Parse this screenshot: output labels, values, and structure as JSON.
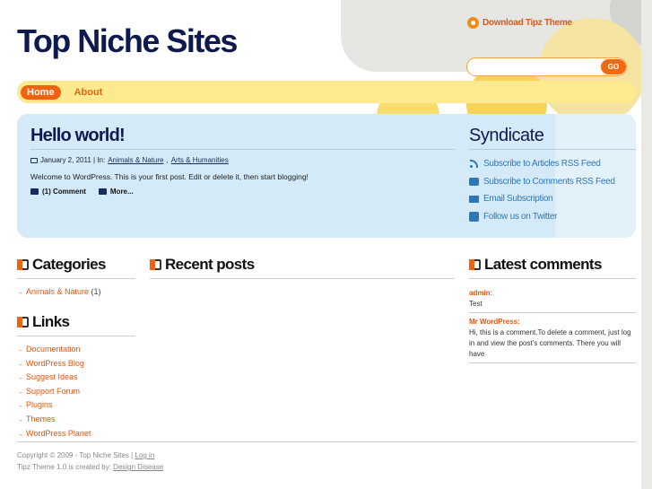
{
  "site": {
    "title": "Top Niche Sites",
    "download_link": "Download Tipz Theme"
  },
  "search": {
    "placeholder": "",
    "button_label": "GO"
  },
  "nav": {
    "items": [
      {
        "label": "Home",
        "active": true
      },
      {
        "label": "About",
        "active": false
      }
    ]
  },
  "post": {
    "title": "Hello world!",
    "date_prefix": "January 2, 2011 | In:",
    "categories": [
      "Animals & Nature",
      "Arts & Humanities"
    ],
    "category_separator": ",",
    "body": "Welcome to WordPress. This is your first post. Edit or delete it, then start blogging!",
    "comments_label": "(1) Comment",
    "more_label": "More..."
  },
  "syndicate": {
    "title": "Syndicate",
    "items": [
      {
        "label": "Subscribe to Articles RSS Feed",
        "icon": "rss-icon"
      },
      {
        "label": "Subscribe to Comments RSS Feed",
        "icon": "comment-icon"
      },
      {
        "label": "Email Subscription",
        "icon": "mail-icon"
      },
      {
        "label": "Follow us on Twitter",
        "icon": "twitter-icon"
      }
    ]
  },
  "categories_widget": {
    "title": "Categories",
    "items": [
      {
        "label": "Animals & Nature",
        "count": "(1)"
      }
    ]
  },
  "links_widget": {
    "title": "Links",
    "items": [
      {
        "label": "Documentation"
      },
      {
        "label": "WordPress Blog"
      },
      {
        "label": "Suggest Ideas"
      },
      {
        "label": "Support Forum"
      },
      {
        "label": "Plugins"
      },
      {
        "label": "Themes"
      },
      {
        "label": "WordPress Planet"
      }
    ]
  },
  "recent_posts_widget": {
    "title": "Recent posts"
  },
  "latest_comments_widget": {
    "title": "Latest comments",
    "comments": [
      {
        "author": "admin:",
        "text": "Test"
      },
      {
        "author": "Mr WordPress:",
        "text": "Hi, this is a comment.To delete a comment, just log in and view the post's comments. There you will have"
      }
    ]
  },
  "footer": {
    "copyright": "Copyright © 2009 - Top Niche Sites |",
    "login_label": "Log in",
    "credit_prefix": "Tipz Theme 1.0 is created by:",
    "credit_link": "Design Disease"
  },
  "colors": {
    "accent": "#f1620f",
    "title_navy": "#0e1a4d",
    "nav_yellow": "#fde98f",
    "panel_blue": "#d4eaf8",
    "link_blue": "#2e77b7"
  }
}
